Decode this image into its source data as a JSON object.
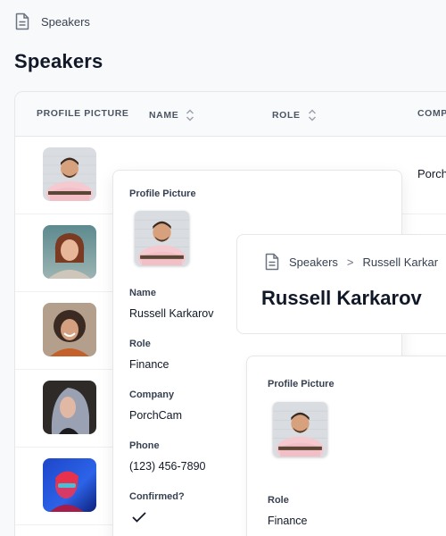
{
  "breadcrumb": {
    "label": "Speakers"
  },
  "page": {
    "title": "Speakers"
  },
  "table": {
    "columns": [
      {
        "label": "PROFILE PICTURE",
        "sortable": false
      },
      {
        "label": "NAME",
        "sortable": true
      },
      {
        "label": "ROLE",
        "sortable": true
      },
      {
        "label": "COMP",
        "sortable": false
      }
    ],
    "rows": [
      {
        "avatar": "avatar-man-checked-shirt",
        "company": "Porch"
      },
      {
        "avatar": "avatar-woman-bob-hair",
        "company": ""
      },
      {
        "avatar": "avatar-woman-curly-hair",
        "company": ""
      },
      {
        "avatar": "avatar-woman-grey-hair",
        "company": ""
      },
      {
        "avatar": "avatar-woman-neon-light",
        "company": ""
      }
    ]
  },
  "popover": {
    "profile_picture_label": "Profile Picture",
    "name_label": "Name",
    "name": "Russell Karkarov",
    "role_label": "Role",
    "role": "Finance",
    "company_label": "Company",
    "company": "PorchCam",
    "phone_label": "Phone",
    "phone": "(123) 456-7890",
    "confirmed_label": "Confirmed?",
    "confirmed": true
  },
  "detail": {
    "breadcrumb_root": "Speakers",
    "breadcrumb_separator": ">",
    "breadcrumb_current": "Russell Karkar",
    "title": "Russell Karkarov",
    "profile_picture_label": "Profile Picture",
    "role_label": "Role",
    "role": "Finance"
  },
  "colors": {
    "background": "#f8f9fa",
    "card": "#ffffff",
    "border": "#e5e7eb",
    "text": "#111827",
    "muted": "#4b5563"
  },
  "icons": [
    "document-icon",
    "sort-icon",
    "chevron-right-icon",
    "check-icon"
  ]
}
